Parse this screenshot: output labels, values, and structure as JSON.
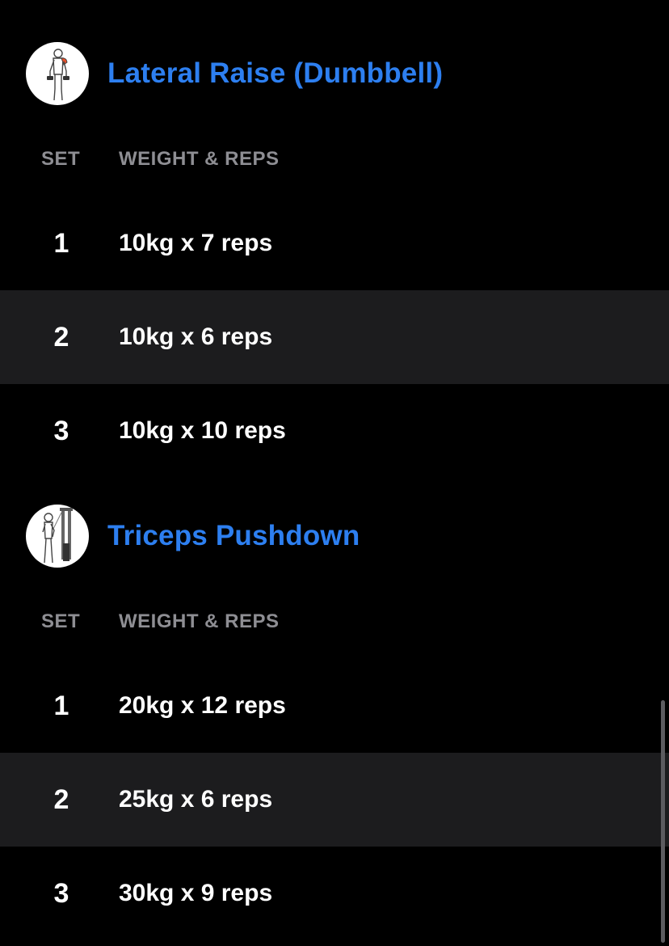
{
  "columns": {
    "set": "SET",
    "weight_reps": "WEIGHT & REPS"
  },
  "exercises": [
    {
      "title": "Lateral Raise (Dumbbell)",
      "thumbnail_icon": "lateral-raise-figure-icon",
      "sets": [
        {
          "set": "1",
          "value": "10kg x 7 reps"
        },
        {
          "set": "2",
          "value": "10kg x 6 reps"
        },
        {
          "set": "3",
          "value": "10kg x 10 reps"
        }
      ]
    },
    {
      "title": "Triceps Pushdown",
      "thumbnail_icon": "triceps-pushdown-figure-icon",
      "sets": [
        {
          "set": "1",
          "value": "20kg x 12 reps"
        },
        {
          "set": "2",
          "value": "25kg x 6 reps"
        },
        {
          "set": "3",
          "value": "30kg x 9 reps"
        }
      ]
    }
  ],
  "colors": {
    "background": "#000000",
    "title_accent": "#2d7ff0",
    "alt_row": "#1c1c1e",
    "header_text": "#8e8e93"
  }
}
